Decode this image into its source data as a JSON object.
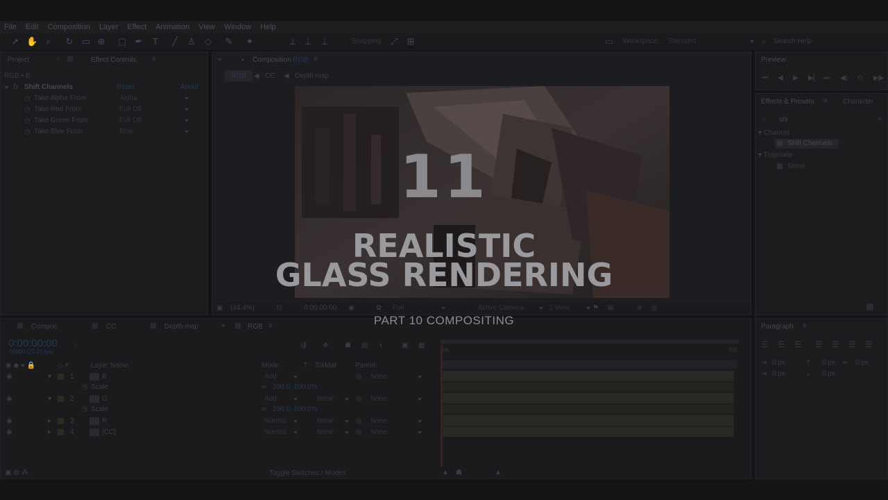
{
  "menu": [
    "File",
    "Edit",
    "Composition",
    "Layer",
    "Effect",
    "Animation",
    "View",
    "Window",
    "Help"
  ],
  "toolbar": {
    "snapping": "Snapping",
    "workspace_label": "Workspace:",
    "workspace_value": "Standard",
    "search_help": "Search Help"
  },
  "project_panel": {
    "tab_project": "Project",
    "tab_effect_controls": "Effect Controls",
    "layer_path": "RGB • B"
  },
  "effect": {
    "name": "Shift Channels",
    "reset": "Reset",
    "about": "About",
    "props": [
      {
        "label": "Take Alpha From",
        "value": "Alpha"
      },
      {
        "label": "Take Red From",
        "value": "Full Off"
      },
      {
        "label": "Take Green From",
        "value": "Full Off"
      },
      {
        "label": "Take Blue From",
        "value": "Blue"
      }
    ]
  },
  "composition": {
    "tab": "Composition",
    "tab_name": "RGB",
    "flow": [
      "RGB",
      "CC",
      "Depth map"
    ],
    "zoom": "(44.4%)",
    "timecode": "0:00:00:00",
    "resolution": "Full",
    "camera": "Active Camera",
    "views": "1 View"
  },
  "preview": {
    "title": "Preview"
  },
  "effects_presets": {
    "tab1": "Effects & Presets",
    "tab2": "Character",
    "search": "shi",
    "groups": [
      {
        "name": "Channel",
        "items": [
          "Shift Channels"
        ]
      },
      {
        "name": "Trapcode",
        "items": [
          "Shine"
        ]
      }
    ]
  },
  "paragraph": {
    "title": "Paragraph",
    "v1": "0 px",
    "v2": "0 px",
    "v3": "0 px",
    "v4": "0 px",
    "v5": "0 px"
  },
  "timeline": {
    "tabs": [
      "Compos",
      "CC",
      "Depth map",
      "RGB"
    ],
    "timecode": "0:00:00:00",
    "fps": "00000 (25.00 fps)",
    "headers": {
      "layer_name": "Layer Name",
      "mode": "Mode",
      "t": "T",
      "trkmat": "TrkMat",
      "parent": "Parent"
    },
    "layers": [
      {
        "num": "1",
        "name": "B",
        "mode": "Add",
        "trkmat": "",
        "parent": "None",
        "sub": "Scale",
        "subval": "100.0, 100.0%"
      },
      {
        "num": "2",
        "name": "G",
        "mode": "Add",
        "trkmat": "None",
        "parent": "None",
        "sub": "Scale",
        "subval": "100.0, 100.0%"
      },
      {
        "num": "3",
        "name": "R",
        "mode": "Normal",
        "trkmat": "None",
        "parent": "None"
      },
      {
        "num": "4",
        "name": "[CC]",
        "mode": "Normal",
        "trkmat": "None",
        "parent": "None"
      }
    ],
    "toggle": "Toggle Switches / Modes",
    "ruler_start": "0s",
    "ruler_end": "01f"
  },
  "overlay": {
    "number": "11",
    "title_line1": "REALISTIC",
    "title_line2": "GLASS RENDERING",
    "subtitle": "PART 10 COMPOSITING"
  }
}
